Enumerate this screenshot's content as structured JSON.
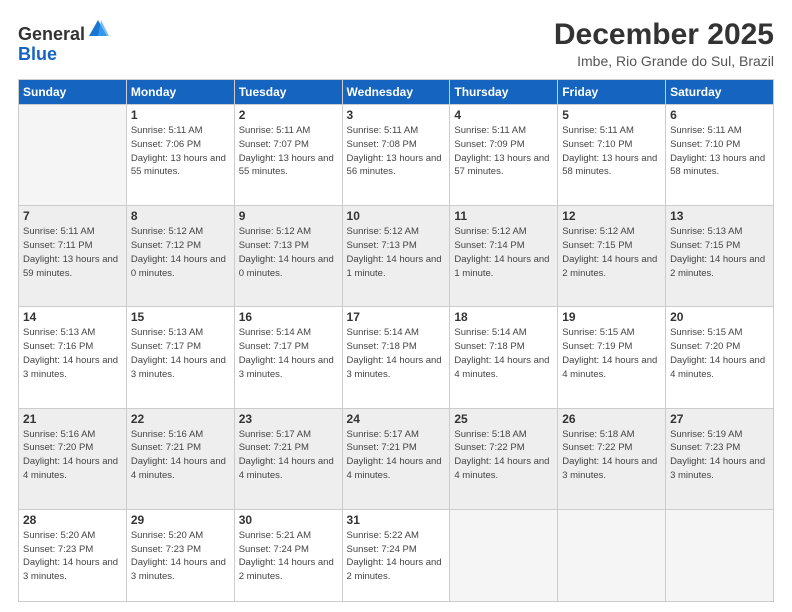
{
  "logo": {
    "general": "General",
    "blue": "Blue"
  },
  "header": {
    "title": "December 2025",
    "subtitle": "Imbe, Rio Grande do Sul, Brazil"
  },
  "weekdays": [
    "Sunday",
    "Monday",
    "Tuesday",
    "Wednesday",
    "Thursday",
    "Friday",
    "Saturday"
  ],
  "weeks": [
    [
      {
        "day": "",
        "empty": true
      },
      {
        "day": "1",
        "sunrise": "Sunrise: 5:11 AM",
        "sunset": "Sunset: 7:06 PM",
        "daylight": "Daylight: 13 hours and 55 minutes."
      },
      {
        "day": "2",
        "sunrise": "Sunrise: 5:11 AM",
        "sunset": "Sunset: 7:07 PM",
        "daylight": "Daylight: 13 hours and 55 minutes."
      },
      {
        "day": "3",
        "sunrise": "Sunrise: 5:11 AM",
        "sunset": "Sunset: 7:08 PM",
        "daylight": "Daylight: 13 hours and 56 minutes."
      },
      {
        "day": "4",
        "sunrise": "Sunrise: 5:11 AM",
        "sunset": "Sunset: 7:09 PM",
        "daylight": "Daylight: 13 hours and 57 minutes."
      },
      {
        "day": "5",
        "sunrise": "Sunrise: 5:11 AM",
        "sunset": "Sunset: 7:10 PM",
        "daylight": "Daylight: 13 hours and 58 minutes."
      },
      {
        "day": "6",
        "sunrise": "Sunrise: 5:11 AM",
        "sunset": "Sunset: 7:10 PM",
        "daylight": "Daylight: 13 hours and 58 minutes."
      }
    ],
    [
      {
        "day": "7",
        "sunrise": "Sunrise: 5:11 AM",
        "sunset": "Sunset: 7:11 PM",
        "daylight": "Daylight: 13 hours and 59 minutes."
      },
      {
        "day": "8",
        "sunrise": "Sunrise: 5:12 AM",
        "sunset": "Sunset: 7:12 PM",
        "daylight": "Daylight: 14 hours and 0 minutes."
      },
      {
        "day": "9",
        "sunrise": "Sunrise: 5:12 AM",
        "sunset": "Sunset: 7:13 PM",
        "daylight": "Daylight: 14 hours and 0 minutes."
      },
      {
        "day": "10",
        "sunrise": "Sunrise: 5:12 AM",
        "sunset": "Sunset: 7:13 PM",
        "daylight": "Daylight: 14 hours and 1 minute."
      },
      {
        "day": "11",
        "sunrise": "Sunrise: 5:12 AM",
        "sunset": "Sunset: 7:14 PM",
        "daylight": "Daylight: 14 hours and 1 minute."
      },
      {
        "day": "12",
        "sunrise": "Sunrise: 5:12 AM",
        "sunset": "Sunset: 7:15 PM",
        "daylight": "Daylight: 14 hours and 2 minutes."
      },
      {
        "day": "13",
        "sunrise": "Sunrise: 5:13 AM",
        "sunset": "Sunset: 7:15 PM",
        "daylight": "Daylight: 14 hours and 2 minutes."
      }
    ],
    [
      {
        "day": "14",
        "sunrise": "Sunrise: 5:13 AM",
        "sunset": "Sunset: 7:16 PM",
        "daylight": "Daylight: 14 hours and 3 minutes."
      },
      {
        "day": "15",
        "sunrise": "Sunrise: 5:13 AM",
        "sunset": "Sunset: 7:17 PM",
        "daylight": "Daylight: 14 hours and 3 minutes."
      },
      {
        "day": "16",
        "sunrise": "Sunrise: 5:14 AM",
        "sunset": "Sunset: 7:17 PM",
        "daylight": "Daylight: 14 hours and 3 minutes."
      },
      {
        "day": "17",
        "sunrise": "Sunrise: 5:14 AM",
        "sunset": "Sunset: 7:18 PM",
        "daylight": "Daylight: 14 hours and 3 minutes."
      },
      {
        "day": "18",
        "sunrise": "Sunrise: 5:14 AM",
        "sunset": "Sunset: 7:18 PM",
        "daylight": "Daylight: 14 hours and 4 minutes."
      },
      {
        "day": "19",
        "sunrise": "Sunrise: 5:15 AM",
        "sunset": "Sunset: 7:19 PM",
        "daylight": "Daylight: 14 hours and 4 minutes."
      },
      {
        "day": "20",
        "sunrise": "Sunrise: 5:15 AM",
        "sunset": "Sunset: 7:20 PM",
        "daylight": "Daylight: 14 hours and 4 minutes."
      }
    ],
    [
      {
        "day": "21",
        "sunrise": "Sunrise: 5:16 AM",
        "sunset": "Sunset: 7:20 PM",
        "daylight": "Daylight: 14 hours and 4 minutes."
      },
      {
        "day": "22",
        "sunrise": "Sunrise: 5:16 AM",
        "sunset": "Sunset: 7:21 PM",
        "daylight": "Daylight: 14 hours and 4 minutes."
      },
      {
        "day": "23",
        "sunrise": "Sunrise: 5:17 AM",
        "sunset": "Sunset: 7:21 PM",
        "daylight": "Daylight: 14 hours and 4 minutes."
      },
      {
        "day": "24",
        "sunrise": "Sunrise: 5:17 AM",
        "sunset": "Sunset: 7:21 PM",
        "daylight": "Daylight: 14 hours and 4 minutes."
      },
      {
        "day": "25",
        "sunrise": "Sunrise: 5:18 AM",
        "sunset": "Sunset: 7:22 PM",
        "daylight": "Daylight: 14 hours and 4 minutes."
      },
      {
        "day": "26",
        "sunrise": "Sunrise: 5:18 AM",
        "sunset": "Sunset: 7:22 PM",
        "daylight": "Daylight: 14 hours and 3 minutes."
      },
      {
        "day": "27",
        "sunrise": "Sunrise: 5:19 AM",
        "sunset": "Sunset: 7:23 PM",
        "daylight": "Daylight: 14 hours and 3 minutes."
      }
    ],
    [
      {
        "day": "28",
        "sunrise": "Sunrise: 5:20 AM",
        "sunset": "Sunset: 7:23 PM",
        "daylight": "Daylight: 14 hours and 3 minutes."
      },
      {
        "day": "29",
        "sunrise": "Sunrise: 5:20 AM",
        "sunset": "Sunset: 7:23 PM",
        "daylight": "Daylight: 14 hours and 3 minutes."
      },
      {
        "day": "30",
        "sunrise": "Sunrise: 5:21 AM",
        "sunset": "Sunset: 7:24 PM",
        "daylight": "Daylight: 14 hours and 2 minutes."
      },
      {
        "day": "31",
        "sunrise": "Sunrise: 5:22 AM",
        "sunset": "Sunset: 7:24 PM",
        "daylight": "Daylight: 14 hours and 2 minutes."
      },
      {
        "day": "",
        "empty": true
      },
      {
        "day": "",
        "empty": true
      },
      {
        "day": "",
        "empty": true
      }
    ]
  ]
}
